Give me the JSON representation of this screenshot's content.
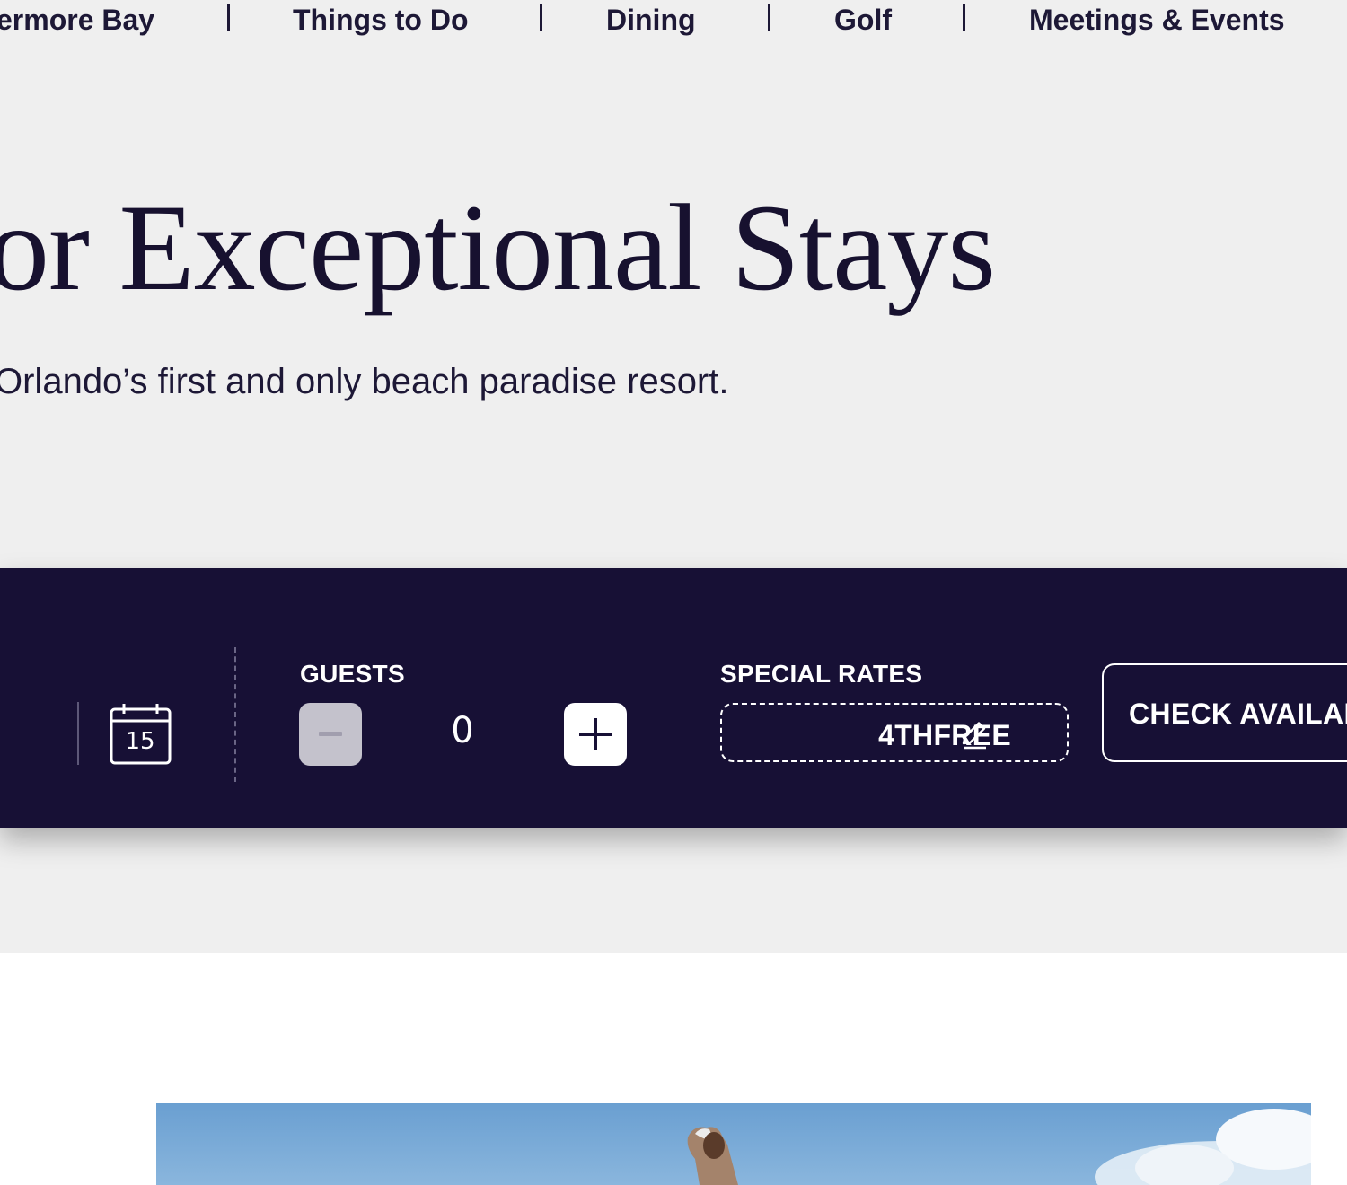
{
  "nav": {
    "items": [
      "ermore Bay",
      "Things to Do",
      "Dining",
      "Golf",
      "Meetings & Events"
    ]
  },
  "hero": {
    "title": "or Exceptional Stays",
    "subtitle": "Orlando’s first and only beach paradise resort."
  },
  "booking": {
    "calendar_day": "15",
    "guests_label": "GUESTS",
    "guest_count": "0",
    "rates_label": "SPECIAL RATES",
    "promo_code": "4THFREE",
    "check_label": "CHECK AVAILABILITY"
  },
  "icons": {
    "calendar": "calendar-icon",
    "minus": "minus-icon",
    "plus": "plus-icon",
    "pencil": "pencil-icon"
  },
  "colors": {
    "navy": "#171035",
    "background": "#efefef",
    "disabled_button": "#c4c2cc",
    "white": "#ffffff"
  }
}
